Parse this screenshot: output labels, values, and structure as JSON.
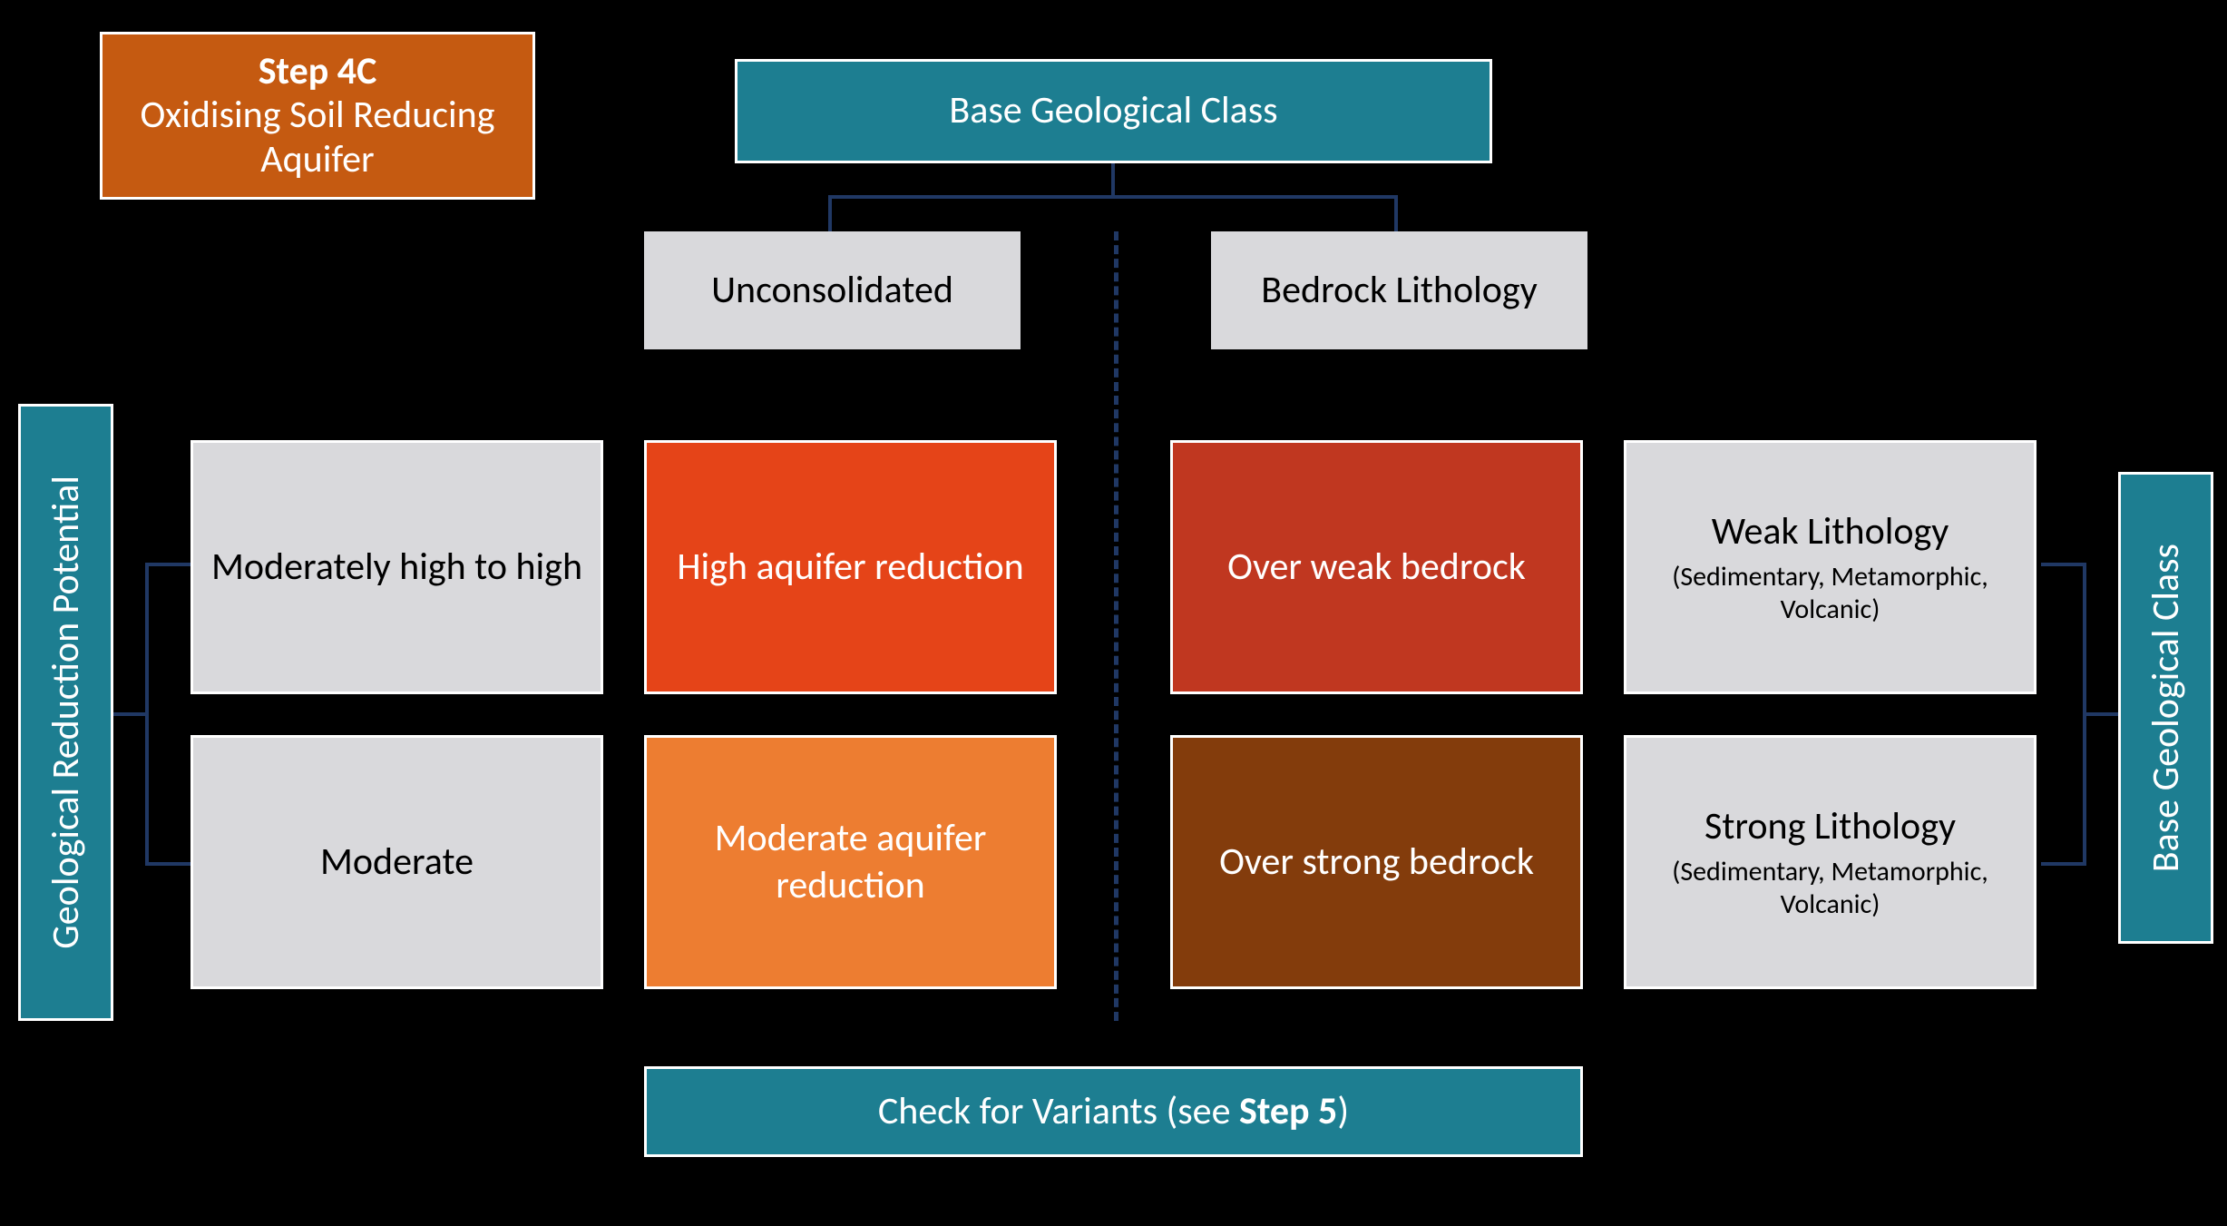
{
  "step": {
    "code": "Step 4C",
    "title": "Oxidising Soil Reducing Aquifer"
  },
  "topHeader": "Base Geological Class",
  "topLeftCategory": "Unconsolidated",
  "topRightCategory": "Bedrock Lithology",
  "leftLabel": "Geological Reduction Potential",
  "rightLabel": "Base Geological Class",
  "rows": {
    "left": {
      "top": "Moderately high to high",
      "bottom": "Moderate"
    },
    "midLeft": {
      "top": "High aquifer reduction",
      "bottom": "Moderate aquifer reduction"
    },
    "midRight": {
      "top": "Over weak bedrock",
      "bottom": "Over strong bedrock"
    },
    "right": {
      "top": {
        "main": "Weak Lithology",
        "sub": "(Sedimentary, Metamorphic, Volcanic)"
      },
      "bottom": {
        "main": "Strong Lithology",
        "sub": "(Sedimentary, Metamorphic, Volcanic)"
      }
    }
  },
  "footer": {
    "prefix": "Check for Variants (see ",
    "bold": "Step 5",
    "suffix": ")"
  }
}
